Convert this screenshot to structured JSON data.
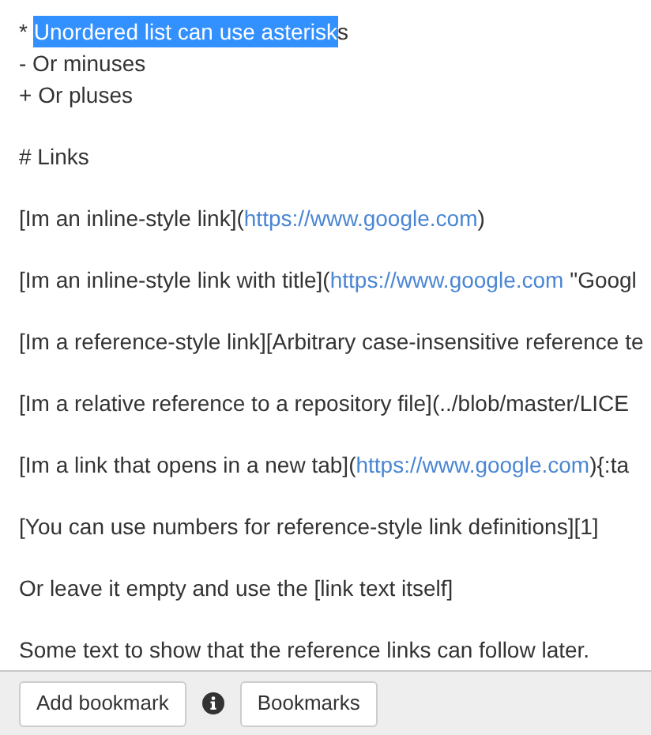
{
  "editor": {
    "blocks": [
      {
        "lines": [
          [
            {
              "kind": "text",
              "text": "* "
            },
            {
              "kind": "selection",
              "text": "Unordered list can use asterisk"
            },
            {
              "kind": "text",
              "text": "s"
            }
          ],
          [
            {
              "kind": "text",
              "text": "- Or minuses"
            }
          ],
          [
            {
              "kind": "text",
              "text": "+ Or pluses"
            }
          ]
        ]
      },
      {
        "lines": [
          [
            {
              "kind": "text",
              "text": "# Links"
            }
          ]
        ]
      },
      {
        "lines": [
          [
            {
              "kind": "text",
              "text": "[Im an inline-style link]("
            },
            {
              "kind": "url",
              "text": "https://www.google.com"
            },
            {
              "kind": "text",
              "text": ")"
            }
          ]
        ]
      },
      {
        "lines": [
          [
            {
              "kind": "text",
              "text": "[Im an inline-style link with title]("
            },
            {
              "kind": "url",
              "text": "https://www.google.com"
            },
            {
              "kind": "text",
              "text": " \"Googl"
            }
          ]
        ]
      },
      {
        "lines": [
          [
            {
              "kind": "text",
              "text": "[Im a reference-style link][Arbitrary case-insensitive reference te"
            }
          ]
        ]
      },
      {
        "lines": [
          [
            {
              "kind": "text",
              "text": "[Im a relative reference to a repository file](../blob/master/LICE"
            }
          ]
        ]
      },
      {
        "lines": [
          [
            {
              "kind": "text",
              "text": "[Im a link that opens in a new tab]("
            },
            {
              "kind": "url",
              "text": "https://www.google.com"
            },
            {
              "kind": "text",
              "text": "){:ta"
            }
          ]
        ]
      },
      {
        "lines": [
          [
            {
              "kind": "text",
              "text": "[You can use numbers for reference-style link definitions][1]"
            }
          ]
        ]
      },
      {
        "lines": [
          [
            {
              "kind": "text",
              "text": "Or leave it empty and use the [link text itself]"
            }
          ]
        ]
      },
      {
        "lines": [
          [
            {
              "kind": "text",
              "text": "Some text to show that the reference links can follow later."
            }
          ]
        ]
      }
    ]
  },
  "toolbar": {
    "buttons": [
      {
        "kind": "button",
        "label": "Add bookmark"
      },
      {
        "kind": "info"
      },
      {
        "kind": "button",
        "label": "Bookmarks"
      }
    ]
  }
}
